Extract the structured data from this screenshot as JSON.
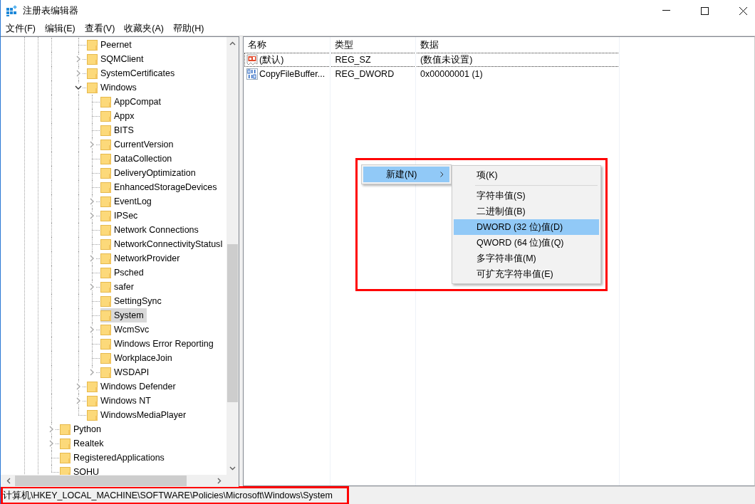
{
  "window": {
    "title": "注册表编辑器"
  },
  "menu_bar": [
    {
      "label": "文件(F)"
    },
    {
      "label": "编辑(E)"
    },
    {
      "label": "查看(V)"
    },
    {
      "label": "收藏夹(A)"
    },
    {
      "label": "帮助(H)"
    }
  ],
  "tree": {
    "items": [
      {
        "children": [
          {
            "children": [
              {
                "label": "Peernet",
                "selected": false
              },
              {
                "label": "SQMClient",
                "selected": false,
                "expanded": false
              },
              {
                "label": "SystemCertificates",
                "selected": false,
                "expanded": false
              },
              {
                "label": "Windows",
                "selected": false,
                "expanded": true,
                "children": [
                  {
                    "label": "AppCompat",
                    "selected": false
                  },
                  {
                    "label": "Appx",
                    "selected": false
                  },
                  {
                    "label": "BITS",
                    "selected": false
                  },
                  {
                    "label": "CurrentVersion",
                    "selected": false,
                    "expanded": false
                  },
                  {
                    "label": "DataCollection",
                    "selected": false
                  },
                  {
                    "label": "DeliveryOptimization",
                    "selected": false
                  },
                  {
                    "label": "EnhancedStorageDevices",
                    "selected": false
                  },
                  {
                    "label": "EventLog",
                    "selected": false,
                    "expanded": false
                  },
                  {
                    "label": "IPSec",
                    "selected": false,
                    "expanded": false
                  },
                  {
                    "label": "Network Connections",
                    "selected": false
                  },
                  {
                    "label": "NetworkConnectivityStatusI",
                    "selected": false
                  },
                  {
                    "label": "NetworkProvider",
                    "selected": false,
                    "expanded": false
                  },
                  {
                    "label": "Psched",
                    "selected": false
                  },
                  {
                    "label": "safer",
                    "selected": false,
                    "expanded": false
                  },
                  {
                    "label": "SettingSync",
                    "selected": false
                  },
                  {
                    "label": "System",
                    "selected": true
                  },
                  {
                    "label": "WcmSvc",
                    "selected": false,
                    "expanded": false
                  },
                  {
                    "label": "Windows Error Reporting",
                    "selected": false
                  },
                  {
                    "label": "WorkplaceJoin",
                    "selected": false
                  },
                  {
                    "label": "WSDAPI",
                    "selected": false,
                    "expanded": false
                  }
                ]
              },
              {
                "label": "Windows Defender",
                "selected": false,
                "expanded": false
              },
              {
                "label": "Windows NT",
                "selected": false,
                "expanded": false
              },
              {
                "label": "WindowsMediaPlayer",
                "selected": false
              }
            ]
          }
        ]
      },
      {
        "label": "Python",
        "selected": false,
        "expanded": false
      },
      {
        "label": "Realtek",
        "selected": false,
        "expanded": false
      },
      {
        "label": "RegisteredApplications",
        "selected": false
      },
      {
        "label": "SOHU",
        "selected": false
      }
    ]
  },
  "values_list": {
    "columns": [
      "名称",
      "类型",
      "数据"
    ],
    "rows": [
      {
        "kind": "string",
        "name": "(默认)",
        "type": "REG_SZ",
        "data": "(数值未设置)",
        "focused": true
      },
      {
        "kind": "binary",
        "name": "CopyFileBuffer...",
        "type": "REG_DWORD",
        "data": "0x00000001 (1)",
        "focused": false
      }
    ]
  },
  "context_menu": {
    "items": [
      {
        "label": "新建(N)",
        "selected": true,
        "has_submenu": true
      }
    ]
  },
  "submenu": {
    "items": [
      {
        "kind": "item",
        "label": "项(K)",
        "selected": false
      },
      {
        "kind": "separator"
      },
      {
        "kind": "item",
        "label": "字符串值(S)",
        "selected": false
      },
      {
        "kind": "item",
        "label": "二进制值(B)",
        "selected": false
      },
      {
        "kind": "item",
        "label": "DWORD (32 位)值(D)",
        "selected": true
      },
      {
        "kind": "item",
        "label": "QWORD (64 位)值(Q)",
        "selected": false
      },
      {
        "kind": "item",
        "label": "多字符串值(M)",
        "selected": false
      },
      {
        "kind": "item",
        "label": "可扩充字符串值(E)",
        "selected": false
      }
    ]
  },
  "status_bar": {
    "path": "计算机\\HKEY_LOCAL_MACHINE\\SOFTWARE\\Policies\\Microsoft\\Windows\\System"
  }
}
